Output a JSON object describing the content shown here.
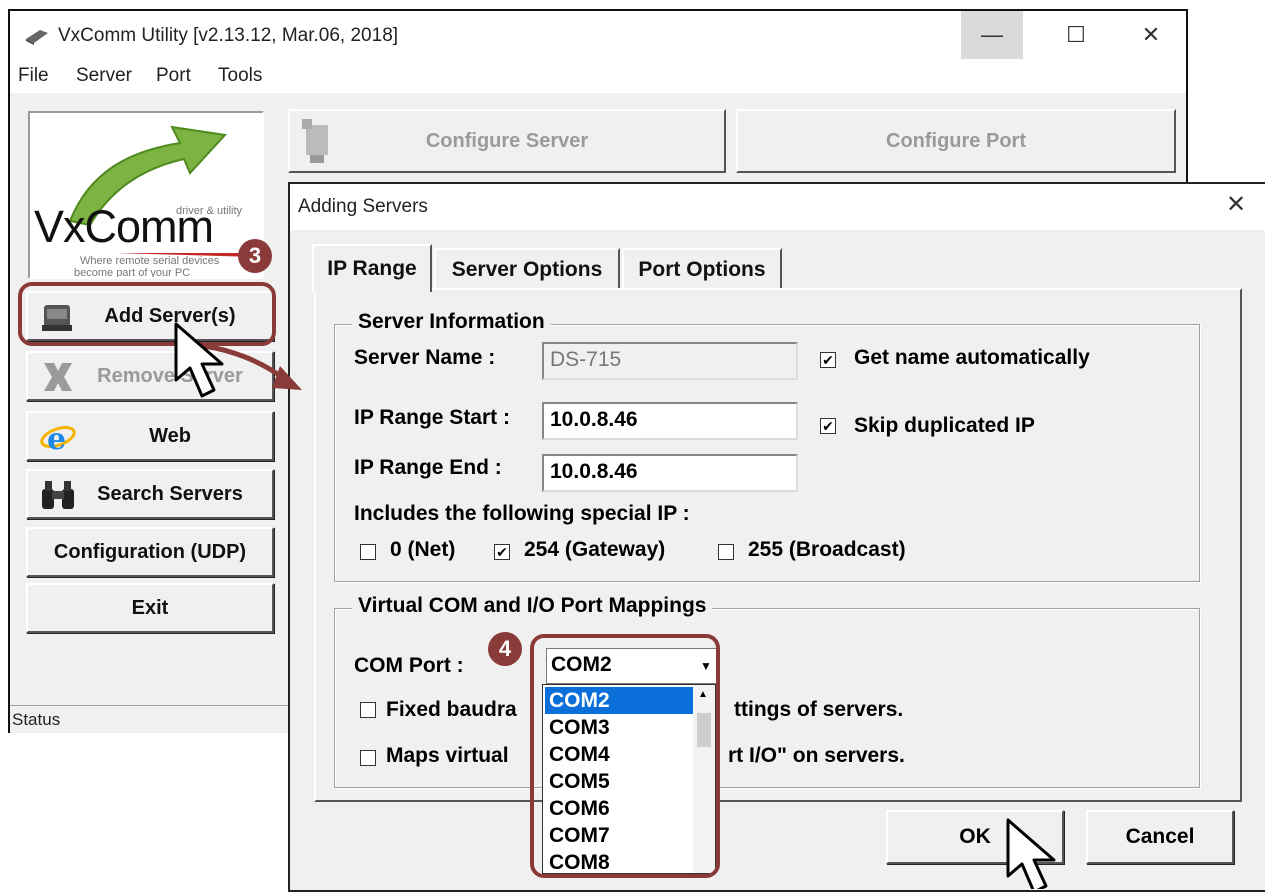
{
  "main_window": {
    "title": "VxComm Utility [v2.13.12, Mar.06, 2018]",
    "controls": {
      "minimize": "—",
      "maximize": "☐",
      "close": "✕"
    },
    "menu": [
      "File",
      "Server",
      "Port",
      "Tools"
    ],
    "logo": {
      "name": "VxComm",
      "tagline": "driver & utility",
      "slogan_1": "Where remote serial devices",
      "slogan_2": "become part of your PC"
    },
    "buttons": {
      "add_servers": "Add Server(s)",
      "remove_server": "Remove Server",
      "web": "Web",
      "search_servers": "Search Servers",
      "configuration_udp": "Configuration (UDP)",
      "exit": "Exit"
    },
    "top_buttons": {
      "configure_server": "Configure Server",
      "configure_port": "Configure Port"
    },
    "status": "Status"
  },
  "dialog": {
    "title": "Adding Servers",
    "close": "✕",
    "tabs": [
      "IP Range",
      "Server Options",
      "Port Options"
    ],
    "server_information": {
      "legend": "Server Information",
      "server_name_label": "Server Name :",
      "server_name_value": "DS-715",
      "get_name_automatically": "Get name automatically",
      "get_name_checked": true,
      "ip_start_label": "IP Range Start :",
      "ip_start_value": "10.0.8.46",
      "skip_duplicated_ip": "Skip duplicated IP",
      "skip_dup_checked": true,
      "ip_end_label": "IP Range End :",
      "ip_end_value": "10.0.8.46",
      "special_ip_label": "Includes the following special IP :",
      "special_ip": [
        {
          "label": "0 (Net)",
          "checked": false
        },
        {
          "label": "254 (Gateway)",
          "checked": true
        },
        {
          "label": "255 (Broadcast)",
          "checked": false
        }
      ]
    },
    "mappings": {
      "legend": "Virtual COM and I/O Port Mappings",
      "com_port_label": "COM Port :",
      "com_port_value": "COM2",
      "options": [
        "COM2",
        "COM3",
        "COM4",
        "COM5",
        "COM6",
        "COM7",
        "COM8"
      ],
      "fixed_baudrate_visible_left": "Fixed baudra",
      "fixed_baudrate_visible_right": "ttings of servers.",
      "maps_virtual_visible_left": "Maps virtual",
      "maps_virtual_visible_right": "rt I/O\" on servers."
    },
    "ok": "OK",
    "cancel": "Cancel"
  },
  "annotations": {
    "step_3": "3",
    "step_4": "4"
  },
  "colors": {
    "annotation": "#8b3a3a",
    "selection": "#0a6fd8"
  }
}
